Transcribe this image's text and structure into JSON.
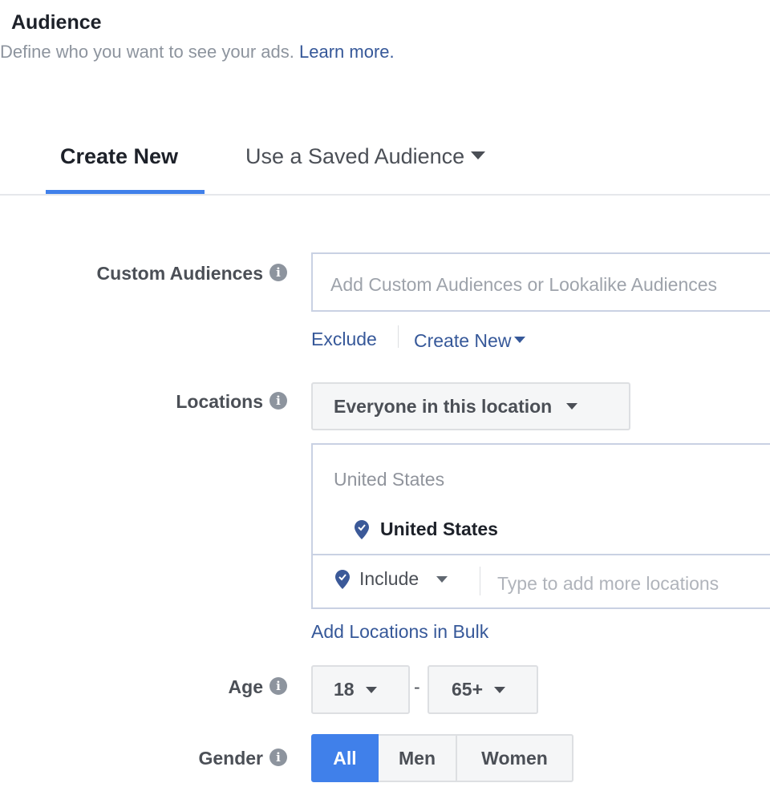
{
  "header": {
    "title": "Audience",
    "subtitle": "Define who you want to see your ads. ",
    "learn_more": "Learn more."
  },
  "tabs": [
    {
      "label": "Create New",
      "active": true
    },
    {
      "label": "Use a Saved Audience",
      "active": false
    }
  ],
  "custom_audiences": {
    "label": "Custom Audiences",
    "placeholder": "Add Custom Audiences or Lookalike Audiences",
    "exclude_link": "Exclude",
    "create_new_link": "Create New"
  },
  "locations": {
    "label": "Locations",
    "dropdown_value": "Everyone in this location",
    "group_header": "United States",
    "selected_location": "United States",
    "include_value": "Include",
    "add_placeholder": "Type to add more locations",
    "bulk_link": "Add Locations in Bulk"
  },
  "age": {
    "label": "Age",
    "min": "18",
    "separator": "-",
    "max": "65+"
  },
  "gender": {
    "label": "Gender",
    "options": [
      "All",
      "Men",
      "Women"
    ],
    "selected": "All"
  },
  "colors": {
    "accent": "#4080ea",
    "link": "#365899",
    "pin": "#3b5998"
  }
}
